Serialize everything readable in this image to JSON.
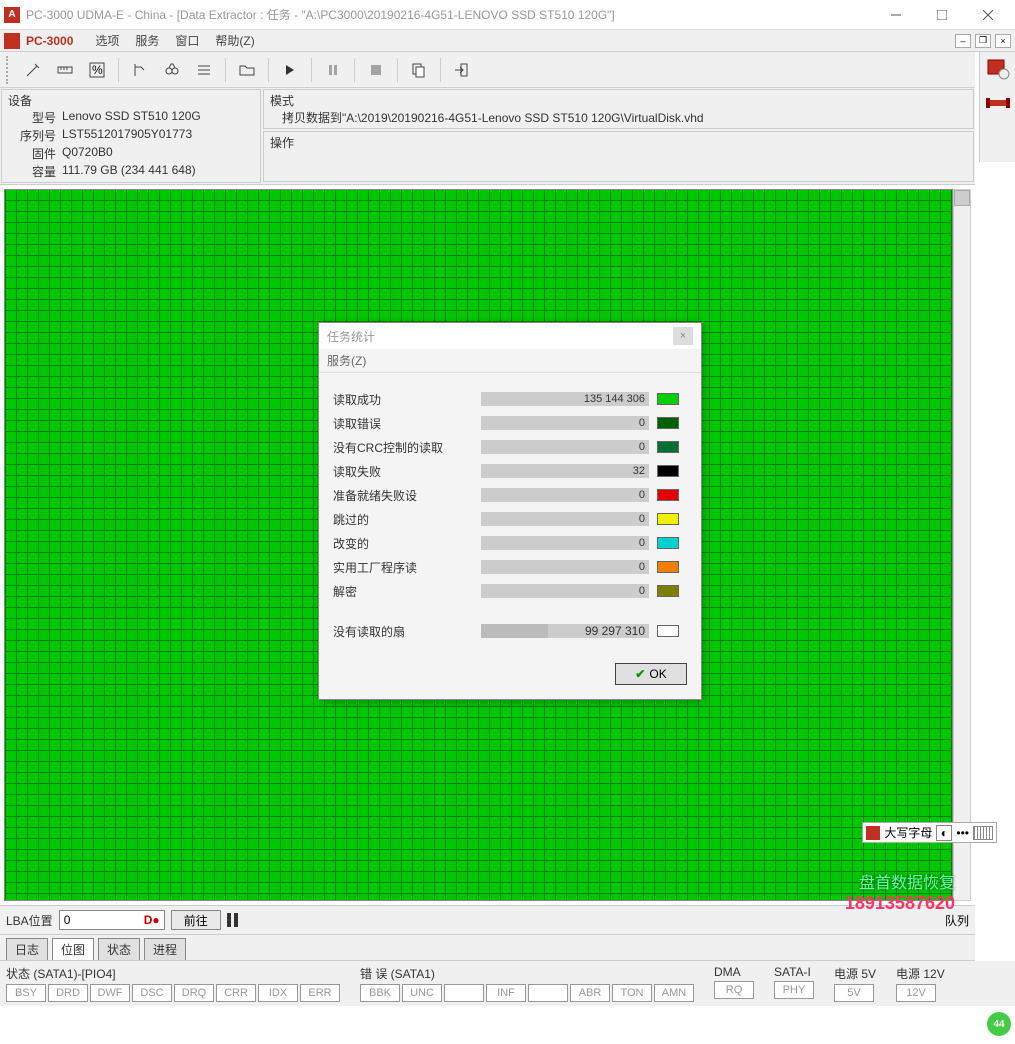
{
  "window": {
    "title": "PC-3000 UDMA-E - China - [Data Extractor : 任务 - \"A:\\PC3000\\20190216-4G51-LENOVO SSD ST510 120G\"]"
  },
  "mdi": {
    "app_name": "PC-3000",
    "menus": [
      "选项",
      "服务",
      "窗口",
      "帮助(Z)"
    ]
  },
  "device": {
    "box_title": "设备",
    "rows": [
      {
        "label": "型号",
        "value": "Lenovo SSD ST510 120G"
      },
      {
        "label": "序列号",
        "value": "LST5512017905Y01773"
      },
      {
        "label": "固件",
        "value": "Q0720B0"
      },
      {
        "label": "容量",
        "value": "111.79 GB (234 441 648)"
      }
    ]
  },
  "mode": {
    "box_title": "模式",
    "line": "拷贝数据到\"A:\\2019\\20190216-4G51-Lenovo SSD ST510 120G\\VirtualDisk.vhd"
  },
  "operation": {
    "box_title": "操作"
  },
  "lba": {
    "label": "LBA位置",
    "value": "0",
    "go": "前往",
    "align": "队列"
  },
  "tabs": [
    "日志",
    "位图",
    "状态",
    "进程"
  ],
  "status_bar": {
    "groups": [
      {
        "title": "状态 (SATA1)-[PIO4]",
        "cells": [
          "BSY",
          "DRD",
          "DWF",
          "DSC",
          "DRQ",
          "CRR",
          "IDX",
          "ERR"
        ]
      },
      {
        "title": "错 误 (SATA1)",
        "cells": [
          "BBK",
          "UNC",
          "",
          "INF",
          "",
          "ABR",
          "TON",
          "AMN"
        ]
      },
      {
        "title": "DMA",
        "cells": [
          "RQ"
        ]
      },
      {
        "title": "SATA-I",
        "cells": [
          "PHY"
        ]
      },
      {
        "title": "电源 5V",
        "cells": [
          "5V"
        ]
      },
      {
        "title": "电源 12V",
        "cells": [
          "12V"
        ]
      }
    ]
  },
  "modal": {
    "title": "任务统计",
    "menu": "服务(Z)",
    "rows": [
      {
        "label": "读取成功",
        "value": "135 144 306",
        "color": "#00d000"
      },
      {
        "label": "读取错误",
        "value": "0",
        "color": "#006000"
      },
      {
        "label": "没有CRC控制的读取",
        "value": "0",
        "color": "#007030"
      },
      {
        "label": "读取失败",
        "value": "32",
        "color": "#000000"
      },
      {
        "label": "准备就绪失败设",
        "value": "0",
        "color": "#e00000"
      },
      {
        "label": "跳过的",
        "value": "0",
        "color": "#f0f000"
      },
      {
        "label": "改变的",
        "value": "0",
        "color": "#00d0d0"
      },
      {
        "label": "实用工厂程序读",
        "value": "0",
        "color": "#f08000"
      },
      {
        "label": "解密",
        "value": "0",
        "color": "#808000"
      }
    ],
    "unread": {
      "label": "没有读取的扇",
      "value": "99 297 310",
      "color": "#ffffff"
    },
    "ok": "OK"
  },
  "caps": {
    "text": "大写字母"
  },
  "watermark": {
    "line1": "盘首数据恢复",
    "line2": "18913587620"
  },
  "badge": "44"
}
